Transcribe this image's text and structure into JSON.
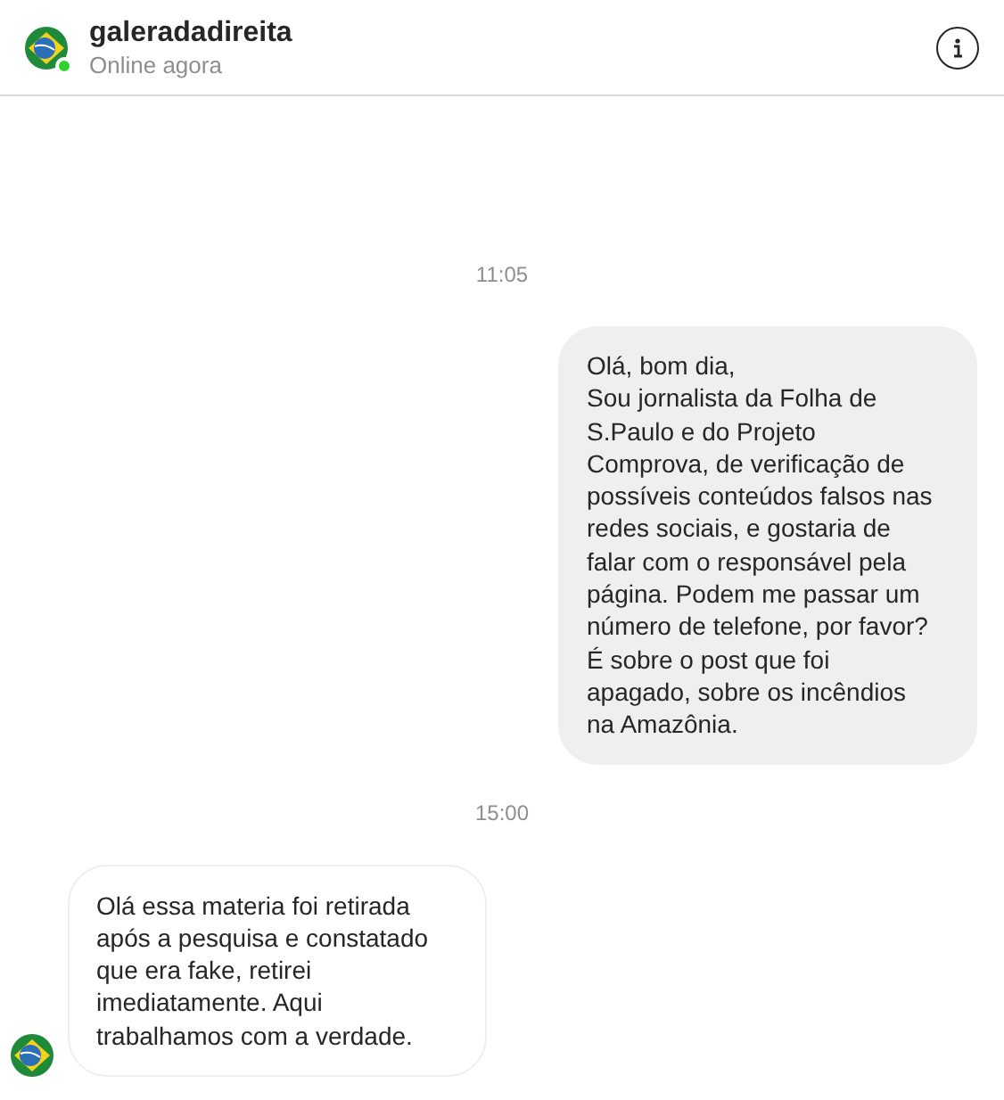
{
  "header": {
    "name": "galeradadireita",
    "status": "Online agora",
    "online": true
  },
  "messages": [
    {
      "kind": "time",
      "text": "11:05"
    },
    {
      "kind": "sent",
      "lines": [
        "Olá, bom dia,",
        "Sou jornalista da Folha de",
        "S.Paulo e do Projeto",
        "Comprova, de verificação de",
        "possíveis conteúdos falsos nas",
        "redes sociais, e gostaria de",
        "falar com o responsável pela",
        "página. Podem me passar um",
        "número de telefone, por favor?",
        "É sobre o post que foi",
        "apagado, sobre os incêndios",
        "na Amazônia."
      ]
    },
    {
      "kind": "time",
      "text": "15:00"
    },
    {
      "kind": "received",
      "lines": [
        "Olá essa materia foi retirada",
        "após a pesquisa e constatado",
        "que era fake, retirei",
        "imediatamente. Aqui",
        "trabalhamos com a verdade."
      ]
    }
  ]
}
